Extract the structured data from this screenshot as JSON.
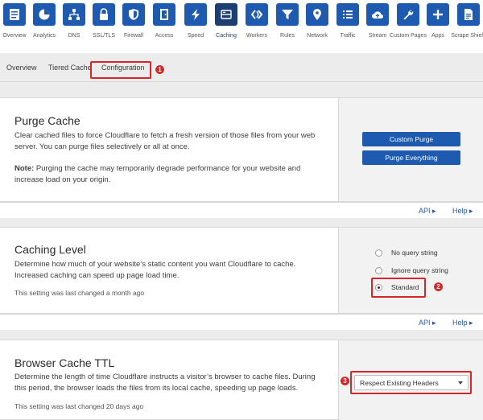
{
  "nav": {
    "items": [
      {
        "label": "Overview",
        "icon": "list-icon"
      },
      {
        "label": "Analytics",
        "icon": "pie-chart-icon"
      },
      {
        "label": "DNS",
        "icon": "sitemap-icon"
      },
      {
        "label": "SSL/TLS",
        "icon": "lock-icon"
      },
      {
        "label": "Firewall",
        "icon": "shield-icon"
      },
      {
        "label": "Access",
        "icon": "door-icon"
      },
      {
        "label": "Speed",
        "icon": "lightning-icon"
      },
      {
        "label": "Caching",
        "icon": "server-icon"
      },
      {
        "label": "Workers",
        "icon": "chevrons-icon"
      },
      {
        "label": "Rules",
        "icon": "filter-icon"
      },
      {
        "label": "Network",
        "icon": "location-pin-icon"
      },
      {
        "label": "Traffic",
        "icon": "bulleted-list-icon"
      },
      {
        "label": "Stream",
        "icon": "cloud-upload-icon"
      },
      {
        "label": "Custom Pages",
        "icon": "wrench-icon"
      },
      {
        "label": "Apps",
        "icon": "plus-icon"
      },
      {
        "label": "Scrape Shield",
        "icon": "document-icon"
      }
    ],
    "active": "Caching"
  },
  "subtabs": {
    "overview": "Overview",
    "tiered_cache": "Tiered Cache",
    "configuration": "Configuration"
  },
  "badges": {
    "one": "1",
    "two": "2",
    "three": "3"
  },
  "purge": {
    "title": "Purge Cache",
    "description": "Clear cached files to force Cloudflare to fetch a fresh version of those files from your web server. You can purge files selectively or all at once.",
    "note_label": "Note:",
    "note_text": " Purging the cache may temporarily degrade performance for your website and increase load on your origin.",
    "custom_purge": "Custom Purge",
    "purge_everything": "Purge Everything"
  },
  "footer": {
    "api": "API ▸",
    "help": "Help ▸"
  },
  "caching_level": {
    "title": "Caching Level",
    "description": "Determine how much of your website’s static content you want Cloudflare to cache. Increased caching can speed up page load time.",
    "meta": "This setting was last changed a month ago",
    "options": [
      "No query string",
      "Ignore query string",
      "Standard"
    ],
    "selected": "Standard"
  },
  "browser_ttl": {
    "title": "Browser Cache TTL",
    "description": "Determine the length of time Cloudflare instructs a visitor’s browser to cache files. During this period, the browser loads the files from its local cache, speeding up page loads.",
    "meta": "This setting was last changed 20 days ago",
    "selected": "Respect Existing Headers"
  },
  "colors": {
    "accent": "#1d5ab0",
    "active_nav": "#1c3e71",
    "highlight": "#d52727"
  }
}
